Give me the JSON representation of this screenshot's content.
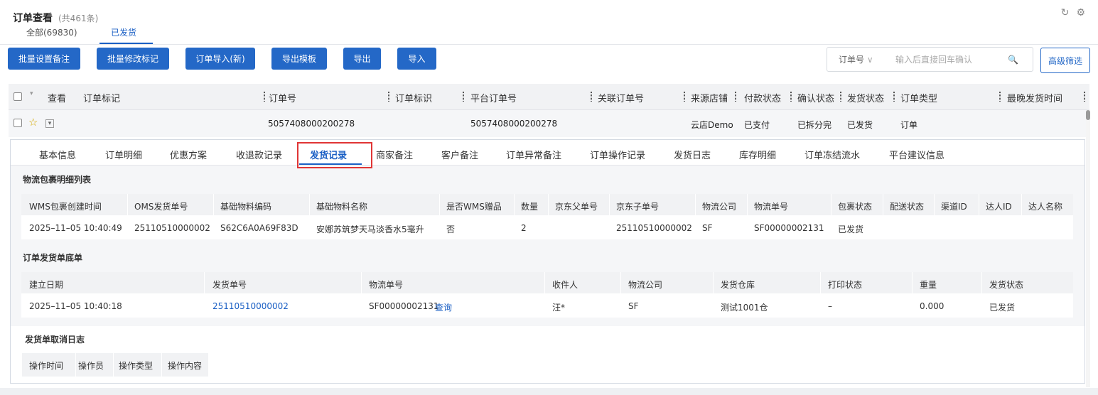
{
  "header": {
    "title": "订单查看",
    "count": "(共461条)",
    "refresh_icon": "↻",
    "settings_icon": "⚙"
  },
  "tabs": [
    {
      "label": "全部(69830)"
    },
    {
      "label": "已发货"
    }
  ],
  "toolbar": {
    "buttons": [
      "批量设置备注",
      "批量修改标记",
      "订单导入(新)",
      "导出模板",
      "导出",
      "导入"
    ]
  },
  "search": {
    "type": "订单号",
    "type_arrow": "∨",
    "placeholder": "输入后直接回车确认",
    "icon": "🔍",
    "advanced": "高级筛选"
  },
  "table": {
    "columns": [
      "查看",
      "订单标记",
      "订单号",
      "订单标识",
      "平台订单号",
      "关联订单号",
      "来源店铺",
      "付款状态",
      "确认状态",
      "发货状态",
      "订单类型",
      "最晚发货时间"
    ]
  },
  "row": {
    "star_icon": "☆",
    "expand_icon": "▾",
    "order_no": "5057408000200278",
    "platform_no": "5057408000200278",
    "shop": "云店Demo",
    "pay": "已支付",
    "confirm": "已拆分完",
    "ship": "已发货",
    "type": "订单"
  },
  "subtabs": [
    "基本信息",
    "订单明细",
    "优惠方案",
    "收退款记录",
    "发货记录",
    "商家备注",
    "客户备注",
    "订单异常备注",
    "订单操作记录",
    "发货日志",
    "库存明细",
    "订单冻结流水",
    "平台建议信息"
  ],
  "parcel": {
    "title": "物流包裹明细列表",
    "headers": [
      "WMS包裹创建时间",
      "OMS发货单号",
      "基础物料编码",
      "基础物料名称",
      "是否WMS赠品",
      "数量",
      "京东父单号",
      "京东子单号",
      "物流公司",
      "物流单号",
      "包裹状态",
      "配送状态",
      "渠道ID",
      "达人ID",
      "达人名称"
    ],
    "rows": [
      [
        "2025–11–05 10:40:49",
        "25110510000002",
        "S62C6A0A69F83D",
        "安娜苏筑梦天马淡香水5毫升",
        "否",
        "2",
        "",
        "25110510000002",
        "SF",
        "SF00000002131",
        "已发货",
        "",
        "",
        "",
        ""
      ]
    ]
  },
  "delivery": {
    "title": "订单发货单底单",
    "headers": [
      "建立日期",
      "发货单号",
      "物流单号",
      "收件人",
      "物流公司",
      "发货仓库",
      "打印状态",
      "重量",
      "发货状态"
    ],
    "rows": [
      [
        "2025–11–05 10:40:18",
        "25110510000002",
        "SF00000002131",
        "汪*",
        "SF",
        "测试1001仓",
        "–",
        "0.000",
        "已发货"
      ]
    ],
    "query_label": "查询"
  },
  "cancel": {
    "title": "发货单取消日志",
    "headers": [
      "操作时间",
      "操作员",
      "操作类型",
      "操作内容"
    ]
  }
}
